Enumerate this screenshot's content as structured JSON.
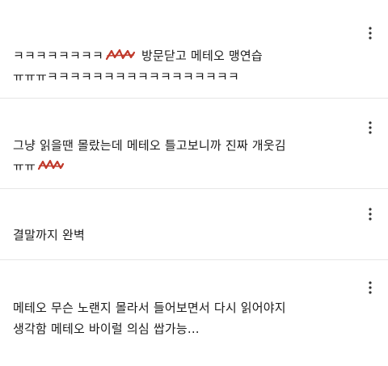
{
  "comments": [
    {
      "line1_before": "ㅋㅋㅋㅋㅋㅋㅋㅋ",
      "line1_after": " 방문닫고 메테오 맹연습",
      "line2": "ㅠㅠㅠㅋㅋㅋㅋㅋㅋㅋㅋㅋㅋㅋㅋㅋㅋㅋㅋㅋ",
      "menu_icon": "more-vertical-icon",
      "redaction_color": "#c0392b"
    },
    {
      "line1": "그냥 읽을땐 몰랐는데 메테오 틀고보니까 진짜 개웃김",
      "line2_before": "ㅠㅠ",
      "menu_icon": "more-vertical-icon",
      "redaction_color": "#c0392b"
    },
    {
      "line1": "결말까지 완벽",
      "menu_icon": "more-vertical-icon"
    },
    {
      "line1": "메테오 무슨 노랜지 몰라서 들어보면서 다시 읽어야지",
      "line2": "생각함 메테오 바이럴 의심 쌉가능...",
      "menu_icon": "more-vertical-icon"
    }
  ]
}
